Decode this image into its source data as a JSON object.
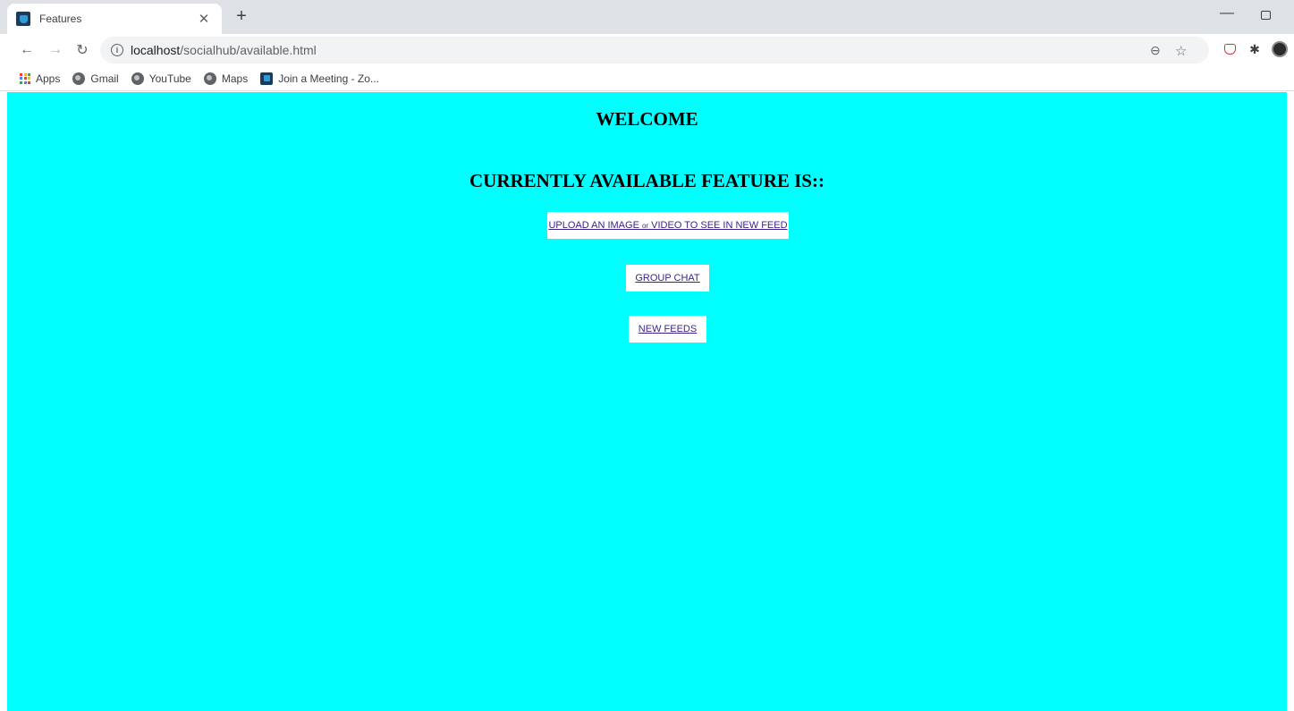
{
  "browser": {
    "tab": {
      "title": "Features"
    },
    "address": {
      "host": "localhost",
      "path": "/socialhub/available.html"
    },
    "bookmarks": [
      {
        "label": "Apps",
        "icon": "apps-grid-icon"
      },
      {
        "label": "Gmail",
        "icon": "globe-icon"
      },
      {
        "label": "YouTube",
        "icon": "globe-icon"
      },
      {
        "label": "Maps",
        "icon": "globe-icon"
      },
      {
        "label": "Join a Meeting - Zo...",
        "icon": "zoom-icon"
      }
    ]
  },
  "page": {
    "background": "#00ffff",
    "welcome": "WELCOME",
    "subtitle": "CURRENTLY AVAILABLE FEATURE IS::",
    "features": {
      "upload": {
        "part1": "UPLOAD AN IMAGE ",
        "small": "or",
        "part2": " VIDEO TO SEE IN NEW FEED"
      },
      "group_chat": "GROUP CHAT",
      "new_feeds": "NEW FEEDS"
    }
  }
}
